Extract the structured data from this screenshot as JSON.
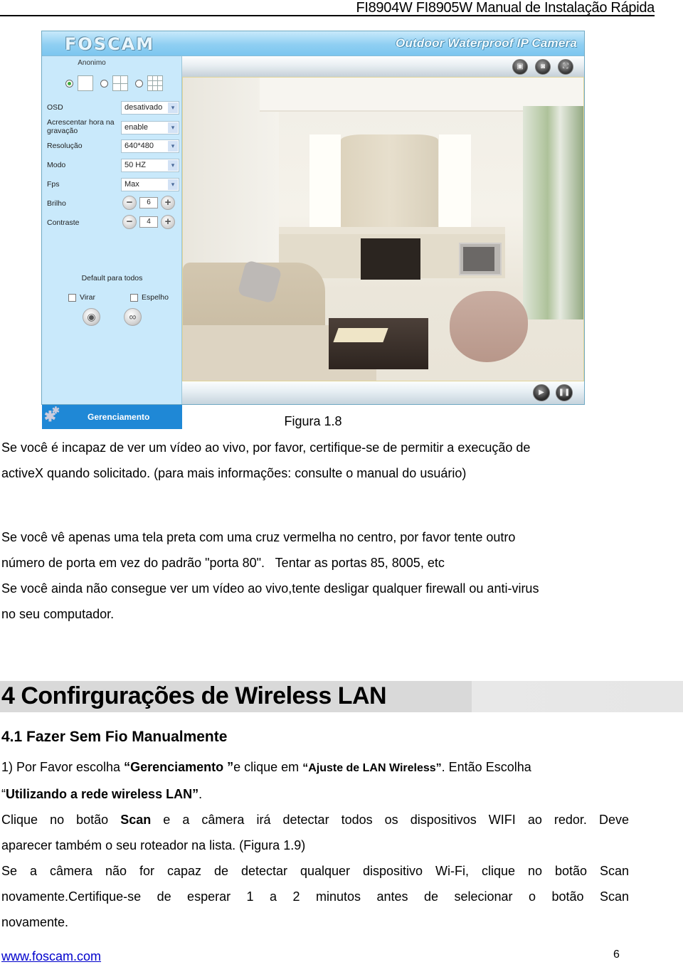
{
  "running_head": "FI8904W FI8905W Manual de Instalação Rápida",
  "camera_ui": {
    "brand": "FOSCAM",
    "header_title": "Outdoor Waterproof IP Camera",
    "user": "Anonimo",
    "layout_options": [
      "single-view",
      "quad-view",
      "nine-view"
    ],
    "layout_selected": 0,
    "fields": [
      {
        "label": "OSD",
        "value": "desativado",
        "type": "select"
      },
      {
        "label": "Acrescentar hora na gravação",
        "value": "enable",
        "type": "select"
      },
      {
        "label": "Resolução",
        "value": "640*480",
        "type": "select"
      },
      {
        "label": "Modo",
        "value": "50 HZ",
        "type": "select"
      },
      {
        "label": "Fps",
        "value": "Max",
        "type": "select"
      },
      {
        "label": "Brilho",
        "value": "6",
        "type": "stepper"
      },
      {
        "label": "Contraste",
        "value": "4",
        "type": "stepper"
      }
    ],
    "default_all_label": "Default para todos",
    "checkboxes": [
      {
        "label": "Virar",
        "checked": false
      },
      {
        "label": "Espelho",
        "checked": false
      }
    ],
    "arrow_glyph": "▾",
    "minus_glyph": "−",
    "plus_glyph": "+",
    "eye_glyph": "◉",
    "noeye_glyph": "∞",
    "manage_label": "Gerenciamento",
    "gear_glyph": "✱",
    "toolbar_glyphs": [
      "▣",
      "◙",
      "⛶"
    ],
    "play_glyph": "▶",
    "pause_glyph": "❚❚"
  },
  "caption": "Figura 1.8",
  "paragraphs": {
    "p1_line1": "Se você é incapaz de ver um vídeo ao vivo, por favor, certifique-se de permitir a execução de",
    "p1_line2": "activeX quando solicitado. (para mais informações: consulte o manual do usuário)",
    "p2_line1": "Se você vê apenas uma tela preta com uma cruz vermelha no centro, por favor tente outro",
    "p2_line2": "número de porta em vez do padrão \"porta 80\".   Tentar as portas 85, 8005, etc",
    "p3_line1": "Se você ainda não consegue ver um vídeo ao vivo,tente desligar qualquer firewall ou anti-virus",
    "p3_line2": "no seu computador."
  },
  "section": {
    "h1": "4 Confirgurações de Wireless LAN",
    "h2": "4.1 Fazer Sem Fio Manualmente",
    "step1_a": "1) Por Favor escolha ",
    "step1_b": "“Gerenciamento ”",
    "step1_c": "e clique em ",
    "step1_d": "“Ajuste de LAN Wireless”",
    "step1_e": ". Então Escolha",
    "step1_f": "“",
    "step1_g": "Utilizando a rede wireless LAN”",
    "step1_h": ".",
    "scan_a": "Clique no botão ",
    "scan_b": "Scan",
    "scan_c": " e a câmera irá detectar todos os dispositivos WIFI ao redor. Deve",
    "scan_line2": "aparecer também o seu roteador na lista. (Figura 1.9)",
    "retry_line1": "Se a câmera não for capaz de detectar qualquer dispositivo Wi-Fi, clique no botão Scan",
    "retry_line2": "novamente.Certifique-se de esperar 1 a 2 minutos antes de selecionar o botão Scan",
    "retry_line3": "novamente."
  },
  "footer": {
    "link": "www.foscam.com",
    "page": "6"
  }
}
